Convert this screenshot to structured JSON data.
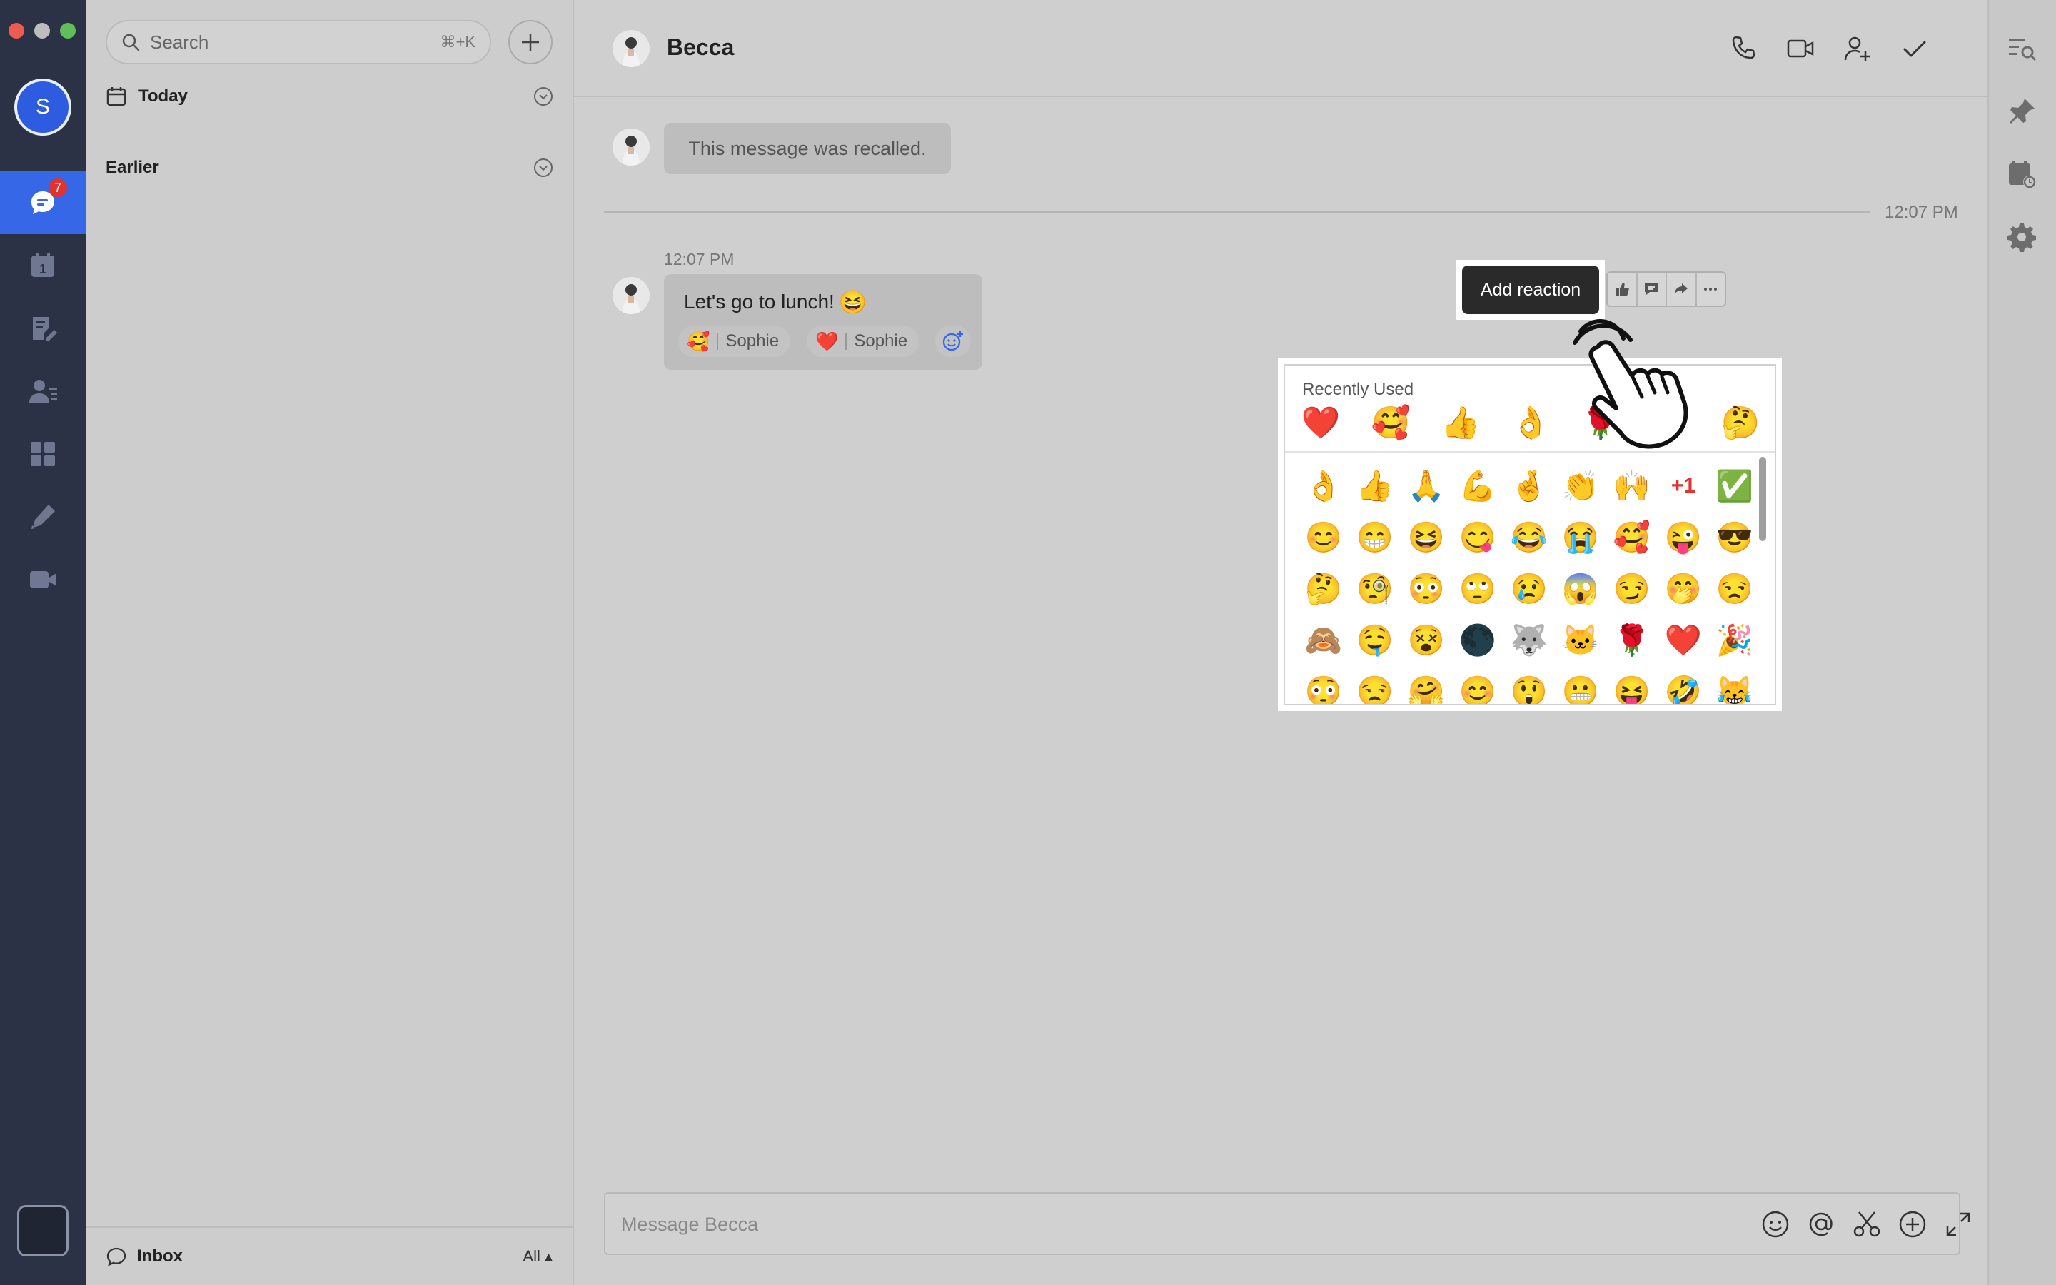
{
  "window": {
    "traffic_lights": [
      "#ed5c53",
      "#bdbdbd",
      "#5fc05a"
    ]
  },
  "profile": {
    "initial": "S"
  },
  "nav": {
    "items": [
      {
        "name": "messages",
        "icon": "chat-bubble-icon",
        "badge": "7",
        "active": true
      },
      {
        "name": "calendar",
        "icon": "calendar-icon",
        "date": "1"
      },
      {
        "name": "docs",
        "icon": "document-edit-icon"
      },
      {
        "name": "contacts",
        "icon": "contacts-icon"
      },
      {
        "name": "workplace",
        "icon": "apps-grid-icon"
      },
      {
        "name": "tasks",
        "icon": "pen-tool-icon"
      },
      {
        "name": "meetings",
        "icon": "video-camera-icon"
      }
    ]
  },
  "search": {
    "placeholder": "Search",
    "shortcut": "⌘+K"
  },
  "list": {
    "sections": [
      {
        "label": "Today"
      },
      {
        "label": "Earlier"
      }
    ],
    "footer": {
      "label": "Inbox",
      "filter": "All"
    }
  },
  "chat": {
    "title": "Becca",
    "recalled_message": "This message was recalled.",
    "separator_time": "12:07 PM",
    "message": {
      "time": "12:07 PM",
      "text": "Let's go to lunch!",
      "emoji": "😆",
      "reactions": [
        {
          "emoji": "🥰",
          "user": "Sophie"
        },
        {
          "emoji": "❤️",
          "user": "Sophie"
        }
      ]
    },
    "tooltip": "Add reaction",
    "composer_placeholder": "Message Becca"
  },
  "picker": {
    "recent_label": "Recently Used",
    "recent": [
      "❤️",
      "🥰",
      "👍",
      "👌",
      "🌹",
      "",
      "🤔"
    ],
    "grid": [
      "👌",
      "👍",
      "🙏",
      "💪",
      "🤞",
      "👏",
      "🙌",
      "+1",
      "✅",
      "😊",
      "😁",
      "😆",
      "😋",
      "😂",
      "😭",
      "🥰",
      "😜",
      "😎",
      "🤔",
      "🧐",
      "😳",
      "🙄",
      "😢",
      "😱",
      "😏",
      "🤭",
      "😒",
      "🙈",
      "🤤",
      "😵",
      "🌑",
      "🐺",
      "🐱",
      "🌹",
      "❤️",
      "🎉",
      "😳",
      "😒",
      "🤗",
      "😊",
      "😲",
      "😬",
      "😝",
      "🤣",
      "😹"
    ]
  }
}
